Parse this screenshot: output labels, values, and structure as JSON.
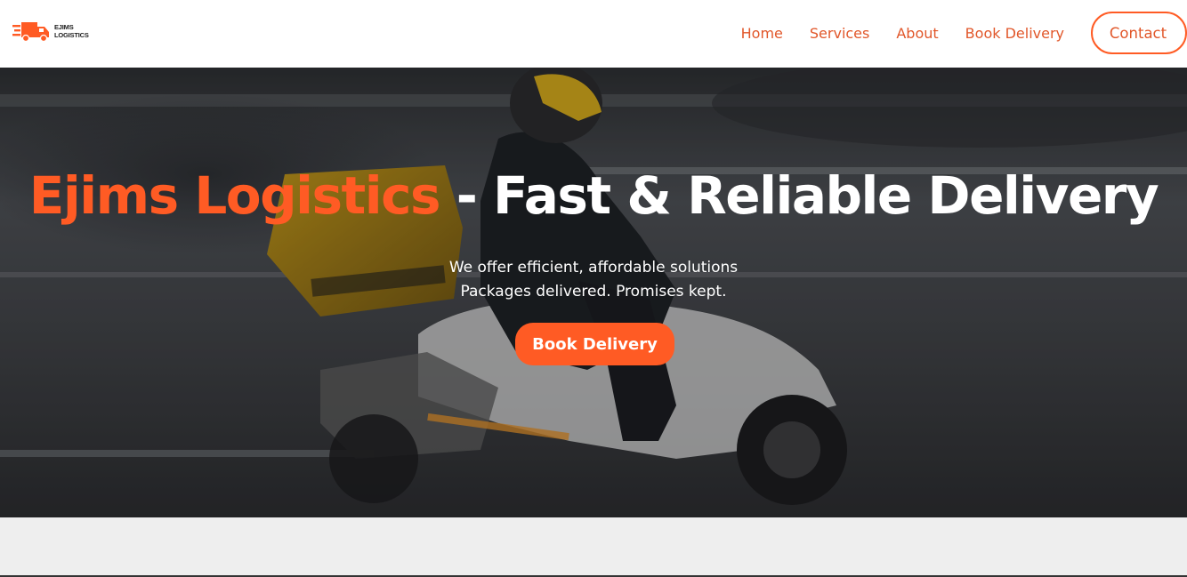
{
  "brand": {
    "logo_line1": "EJIMS",
    "logo_line2": "LOGISTICS",
    "accent_color": "#ff5b24"
  },
  "nav": {
    "items": [
      {
        "label": "Home"
      },
      {
        "label": "Services"
      },
      {
        "label": "About"
      },
      {
        "label": "Book Delivery"
      }
    ],
    "contact_label": "Contact"
  },
  "hero": {
    "title_brand": "Ejims Logistics",
    "title_rest": " - Fast & Reliable Delivery",
    "subtitle_line1": "We offer efficient, affordable solutions",
    "subtitle_line2": "Packages delivered. Promises kept.",
    "cta_label": "Book Delivery",
    "background_image": "delivery-rider-on-scooter"
  }
}
